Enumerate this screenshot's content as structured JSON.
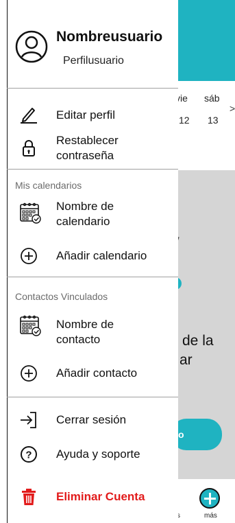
{
  "colors": {
    "accent": "#1fb3c1",
    "danger": "#e21b1b",
    "overlay_gray": "#d5d5d5",
    "divider": "#a0a0a0"
  },
  "background_app": {
    "weekdays": [
      "vie",
      "sáb"
    ],
    "dates": [
      "12",
      "13"
    ],
    "next_arrow": ">",
    "partial_text_1": "de la",
    "partial_text_2": "ar",
    "pill_text": "o",
    "nav_left_fragment": "s",
    "nav_more_label": "más"
  },
  "drawer": {
    "profile": {
      "username": "Nombreusuario",
      "profile_label": "Perfilusuario"
    },
    "account_items": [
      {
        "label": "Editar perfil",
        "icon": "pencil-icon"
      },
      {
        "label": "Restablecer\ncontraseña",
        "icon": "lock-icon"
      }
    ],
    "calendars_section": {
      "title": "Mis calendarios",
      "items": [
        {
          "label": "Nombre de\ncalendario",
          "icon": "calendar-icon"
        },
        {
          "label": "Añadir calendario",
          "icon": "plus-circle-icon"
        }
      ]
    },
    "contacts_section": {
      "title": "Contactos Vinculados",
      "items": [
        {
          "label": "Nombre de\ncontacto",
          "icon": "calendar-icon"
        },
        {
          "label": "Añadir contacto",
          "icon": "plus-circle-icon"
        }
      ]
    },
    "footer_items": [
      {
        "label": "Cerrar sesión",
        "icon": "logout-icon"
      },
      {
        "label": "Ayuda y soporte",
        "icon": "help-icon"
      },
      {
        "label": "Eliminar Cuenta",
        "icon": "trash-icon"
      }
    ]
  }
}
